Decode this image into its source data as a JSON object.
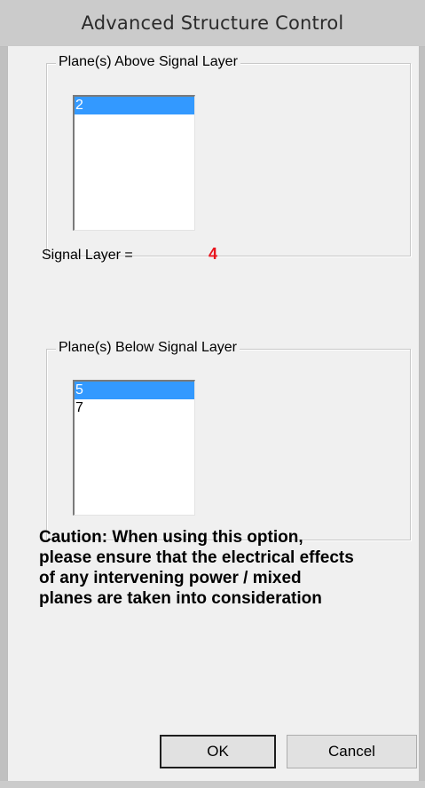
{
  "window": {
    "title": "Advanced Structure Control"
  },
  "above_group": {
    "label": "Plane(s) Above Signal Layer",
    "items": [
      {
        "text": "2",
        "selected": true
      }
    ]
  },
  "signal": {
    "label": "Signal Layer =",
    "value": "4"
  },
  "below_group": {
    "label": "Plane(s) Below Signal Layer",
    "items": [
      {
        "text": "5",
        "selected": true
      },
      {
        "text": "7",
        "selected": false
      }
    ]
  },
  "caution": {
    "text": "Caution: When using this option, please ensure that the electrical effects of any intervening power / mixed planes are taken into consideration"
  },
  "buttons": {
    "ok": "OK",
    "cancel": "Cancel"
  },
  "colors": {
    "selection": "#3399ff",
    "signal_value": "#e8141c",
    "dialog_bg": "#f0f0f0"
  }
}
